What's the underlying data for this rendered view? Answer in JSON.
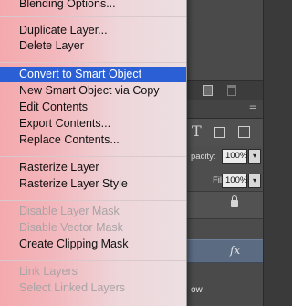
{
  "context_menu": {
    "items": [
      {
        "label": "Blending Options...",
        "enabled": true
      },
      {
        "label": "Duplicate Layer...",
        "enabled": true
      },
      {
        "label": "Delete Layer",
        "enabled": true
      },
      {
        "label": "Convert to Smart Object",
        "enabled": true,
        "highlighted": true
      },
      {
        "label": "New Smart Object via Copy",
        "enabled": true
      },
      {
        "label": "Edit Contents",
        "enabled": true
      },
      {
        "label": "Export Contents...",
        "enabled": true
      },
      {
        "label": "Replace Contents...",
        "enabled": true
      },
      {
        "label": "Rasterize Layer",
        "enabled": true
      },
      {
        "label": "Rasterize Layer Style",
        "enabled": true
      },
      {
        "label": "Disable Layer Mask",
        "enabled": false
      },
      {
        "label": "Disable Vector Mask",
        "enabled": false
      },
      {
        "label": "Create Clipping Mask",
        "enabled": true
      },
      {
        "label": "Link Layers",
        "enabled": false
      },
      {
        "label": "Select Linked Layers",
        "enabled": false
      }
    ],
    "highlight_color": "#2b5fd5"
  },
  "layers_panel": {
    "opacity_label": "pacity:",
    "opacity_value": "100%",
    "fill_label": "Fill:",
    "fill_value": "100%",
    "fx_label": "fx",
    "partial_layer_name": "ow"
  },
  "colors": {
    "panel_bg": "#535353",
    "selected_layer": "#5b6b82"
  }
}
